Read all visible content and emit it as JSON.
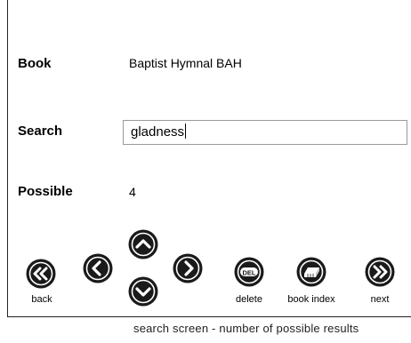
{
  "form": {
    "book_label": "Book",
    "book_value": "Baptist Hymnal BAH",
    "search_label": "Search",
    "search_value": "gladness",
    "possible_label": "Possible",
    "possible_value": "4"
  },
  "toolbar": {
    "back_label": "back",
    "delete_label": "delete",
    "delete_badge": "DEL",
    "book_index_label": "book index",
    "next_label": "next",
    "icons": {
      "back": "double-chevron-left-icon",
      "left": "chevron-left-icon",
      "up": "chevron-up-icon",
      "down": "chevron-down-icon",
      "right": "chevron-right-icon",
      "delete": "del-icon",
      "book_index": "book-icon",
      "next": "double-chevron-right-icon"
    }
  },
  "caption": "search screen - number of possible results",
  "colors": {
    "button_fill": "#1a1a1a",
    "button_ring": "#ffffff",
    "border": "#222222"
  }
}
